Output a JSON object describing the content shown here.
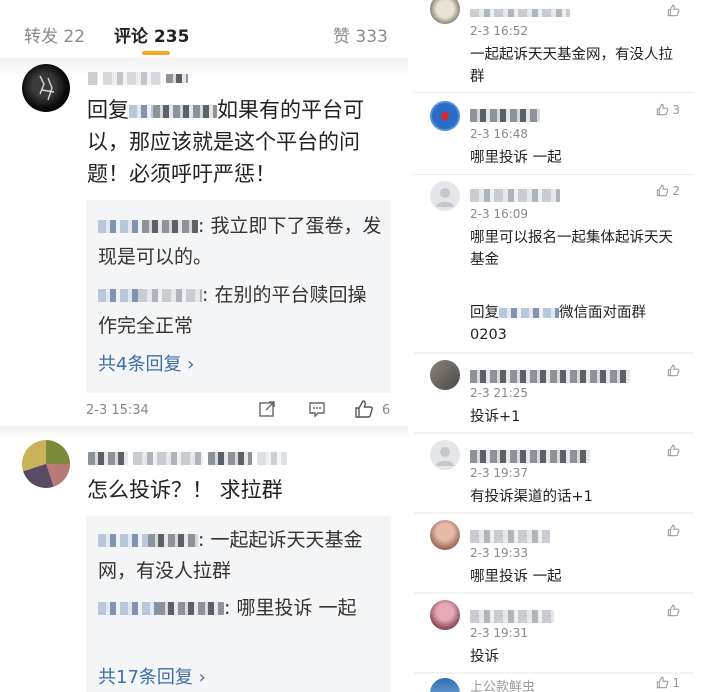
{
  "tabs": {
    "repost": "转发 22",
    "comment": "评论 235",
    "like": "赞 333"
  },
  "comments": [
    {
      "text": "回复：如果有的平台可以，那应该就是这个平台的问题！必须呼吁严惩！",
      "text_prefix": "回复",
      "text_body": "如果有的平台可以，那应该就是这个平台的问题！必须呼吁严惩！",
      "replies": [
        {
          "text": ": 我立即下了蛋卷，发现是可以的。"
        },
        {
          "text": ": 在别的平台赎回操作完全正常"
        }
      ],
      "more": "共4条回复 ›",
      "time": "2-3 15:34",
      "likes": "6"
    },
    {
      "text": "怎么投诉？！ 求拉群",
      "replies": [
        {
          "text": ": 一起起诉天天基金网，有没人拉群"
        },
        {
          "text": ": 哪里投诉 一起"
        }
      ],
      "more": "共17条回复 ›"
    }
  ],
  "right_top": [
    {
      "time": "2-3 16:52",
      "text": "一起起诉天天基金网，有没人拉群",
      "likes": ""
    },
    {
      "time": "2-3 16:48",
      "text": "哪里投诉 一起",
      "likes": "3"
    },
    {
      "time": "2-3 16:09",
      "text": "哪里可以报名一起集体起诉天天基金",
      "likes": "2"
    }
  ],
  "right_bottom": {
    "header_text": "回复：微信面对面群 0203",
    "header_prefix": "回复",
    "header_body": "微信面对面群 0203",
    "items": [
      {
        "time": "2-3 21:25",
        "text": "投诉+1"
      },
      {
        "time": "2-3 19:37",
        "text": "有投诉渠道的话+1"
      },
      {
        "time": "2-3 19:33",
        "text": "哪里投诉 一起"
      },
      {
        "time": "2-3 19:31",
        "text": "投诉"
      }
    ],
    "last_name_partial": "上公款鲜虫",
    "last_likes": "1"
  },
  "colors": {
    "accent": "#f5a623",
    "link": "#3d6ea8",
    "reply_bg": "#f4f5f6",
    "panel_bg": "#f3f3f3"
  }
}
